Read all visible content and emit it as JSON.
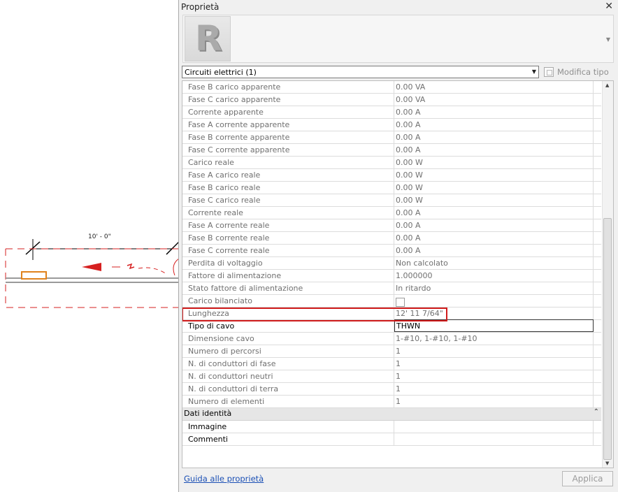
{
  "canvas": {
    "dimension_text": "10' - 0\""
  },
  "palette": {
    "title": "Proprietà",
    "close_icon": "close-icon",
    "type_selector": "Circuiti elettrici (1)",
    "edit_type_label": "Modifica tipo",
    "rows": [
      {
        "label": "Fase B carico apparente",
        "value": "0.00 VA"
      },
      {
        "label": "Fase C carico apparente",
        "value": "0.00 VA"
      },
      {
        "label": "Corrente apparente",
        "value": "0.00 A"
      },
      {
        "label": "Fase A corrente apparente",
        "value": "0.00 A"
      },
      {
        "label": "Fase B corrente apparente",
        "value": "0.00 A"
      },
      {
        "label": "Fase C corrente apparente",
        "value": "0.00 A"
      },
      {
        "label": "Carico reale",
        "value": "0.00 W"
      },
      {
        "label": "Fase A carico reale",
        "value": "0.00 W"
      },
      {
        "label": "Fase B carico reale",
        "value": "0.00 W"
      },
      {
        "label": "Fase C carico reale",
        "value": "0.00 W"
      },
      {
        "label": "Corrente reale",
        "value": "0.00 A"
      },
      {
        "label": "Fase A corrente reale",
        "value": "0.00 A"
      },
      {
        "label": "Fase B corrente reale",
        "value": "0.00 A"
      },
      {
        "label": "Fase C corrente reale",
        "value": "0.00 A"
      },
      {
        "label": "Perdita di voltaggio",
        "value": "Non calcolato"
      },
      {
        "label": "Fattore di alimentazione",
        "value": "1.000000"
      },
      {
        "label": "Stato fattore di alimentazione",
        "value": "In ritardo"
      },
      {
        "label": "Carico bilanciato",
        "value": ""
      },
      {
        "label": "Lunghezza",
        "value": "12'  11 7/64\""
      },
      {
        "label": "Tipo di cavo",
        "value": "THWN"
      },
      {
        "label": "Dimensione cavo",
        "value": "1-#10, 1-#10, 1-#10"
      },
      {
        "label": "Numero di percorsi",
        "value": "1"
      },
      {
        "label": "N. di conduttori di fase",
        "value": "1"
      },
      {
        "label": "N. di conduttori neutri",
        "value": "1"
      },
      {
        "label": "N. di conduttori di terra",
        "value": "1"
      },
      {
        "label": "Numero di elementi",
        "value": "1"
      }
    ],
    "group": {
      "label": "Dati identità",
      "toggle": "⌃"
    },
    "group_rows": [
      {
        "label": "Immagine",
        "value": ""
      },
      {
        "label": "Commenti",
        "value": ""
      }
    ],
    "help_link": "Guida alle proprietà",
    "apply_label": "Applica"
  }
}
